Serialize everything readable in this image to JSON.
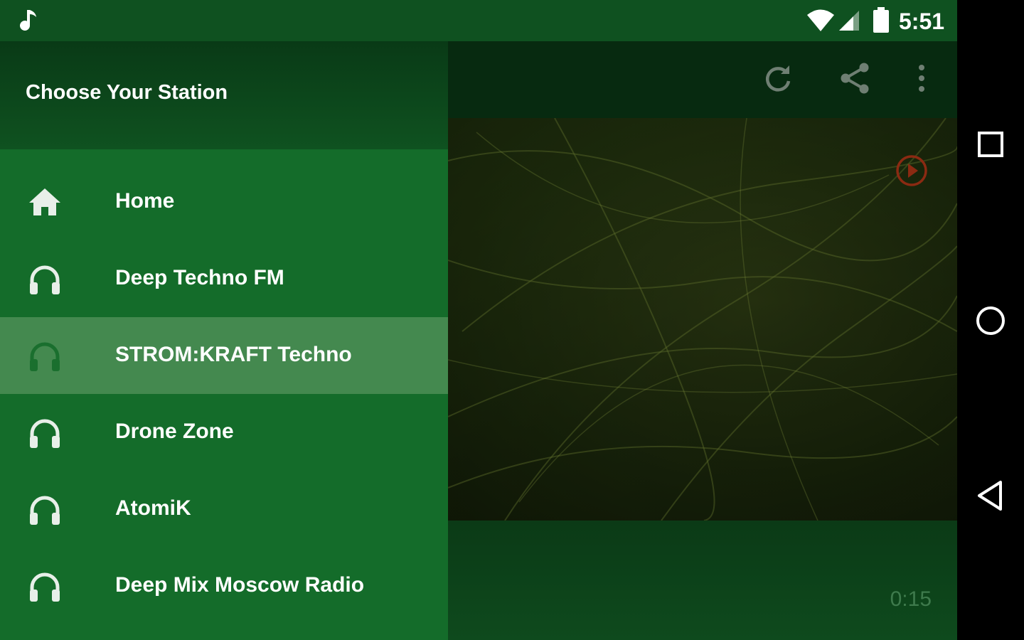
{
  "status_bar": {
    "time": "5:51"
  },
  "drawer": {
    "header_title": "Choose Your Station",
    "items": [
      {
        "label": "Home",
        "icon": "home-icon",
        "selected": false
      },
      {
        "label": "Deep Techno FM",
        "icon": "headphones-icon",
        "selected": false
      },
      {
        "label": "STROM:KRAFT Techno",
        "icon": "headphones-icon",
        "selected": true
      },
      {
        "label": "Drone Zone",
        "icon": "headphones-icon",
        "selected": false
      },
      {
        "label": "AtomiK",
        "icon": "headphones-icon",
        "selected": false
      },
      {
        "label": "Deep Mix Moscow Radio",
        "icon": "headphones-icon",
        "selected": false
      }
    ]
  },
  "toolbar": {
    "actions": [
      "refresh-icon",
      "share-icon",
      "more-vert-icon"
    ]
  },
  "player": {
    "elapsed": "0:15"
  },
  "colors": {
    "primary_dark": "#0f5120",
    "drawer_bg": "#146c2a",
    "selected_item": "#44894f",
    "play_accent": "#8b2a12"
  }
}
